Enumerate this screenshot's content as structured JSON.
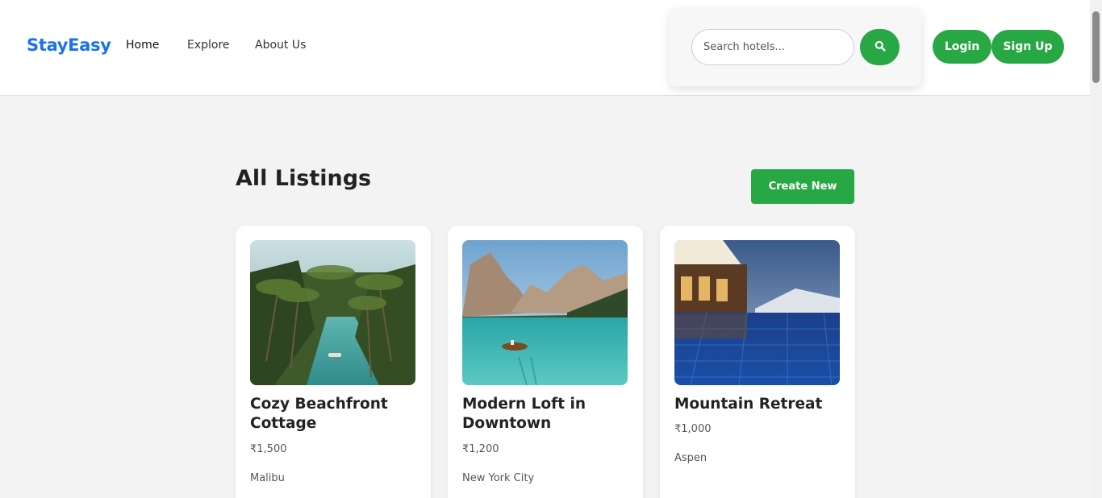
{
  "nav": {
    "brand": "StayEasy",
    "links": [
      "Home",
      "Explore",
      "About Us"
    ]
  },
  "search": {
    "placeholder": "Search hotels...",
    "icon": "search-icon"
  },
  "auth": {
    "login_label": "Login",
    "signup_label": "Sign Up"
  },
  "main": {
    "title": "All Listings",
    "create_label": "Create New"
  },
  "listings": [
    {
      "title": "Cozy Beachfront Cottage",
      "price": "₹1,500",
      "location": "Malibu"
    },
    {
      "title": "Modern Loft in Downtown",
      "price": "₹1,200",
      "location": "New York City"
    },
    {
      "title": "Mountain Retreat",
      "price": "₹1,000",
      "location": "Aspen"
    }
  ],
  "colors": {
    "brand": "#1a73e8",
    "accent": "#28a745"
  }
}
